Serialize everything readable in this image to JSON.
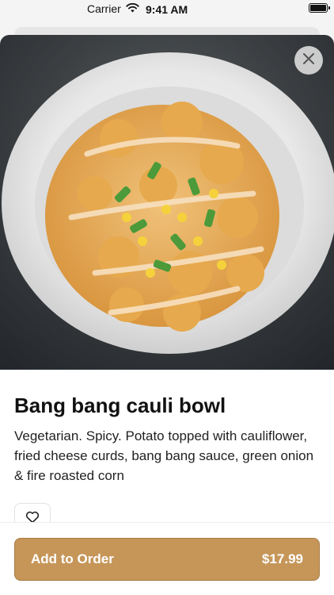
{
  "status_bar": {
    "carrier": "Carrier",
    "time": "9:41 AM"
  },
  "item": {
    "name": "Bang bang cauli bowl",
    "description": "Vegetarian. Spicy. Potato topped with cauliflower, fried cheese curds, bang bang sauce, green onion & fire roasted corn"
  },
  "actions": {
    "add_to_order_label": "Add to Order",
    "price": "$17.99"
  },
  "icons": {
    "close": "close-icon",
    "favorite": "heart-icon",
    "wifi": "wifi-icon",
    "battery": "battery-icon"
  },
  "colors": {
    "accent": "#c69659",
    "accent_border": "#a57a43",
    "text": "#111111"
  }
}
